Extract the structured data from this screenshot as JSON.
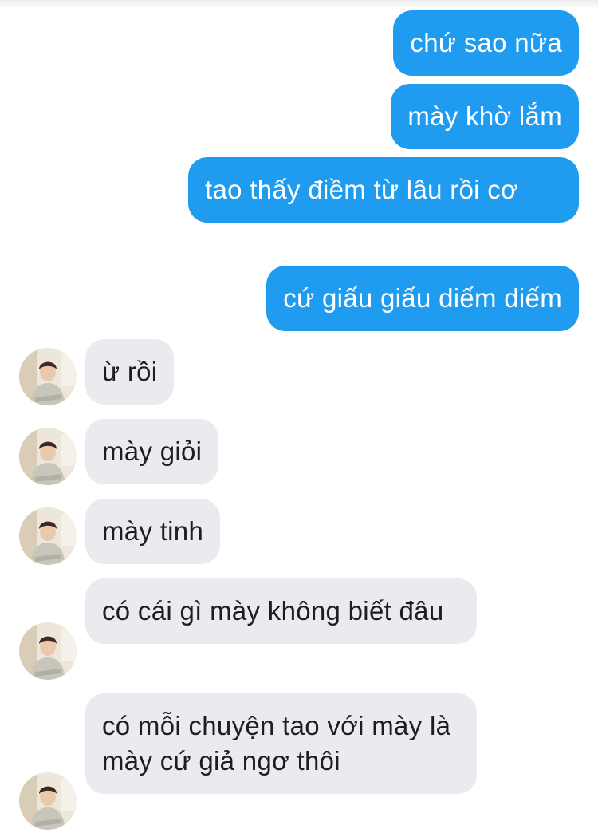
{
  "conversation": {
    "messages": [
      {
        "sender": "me",
        "text": "chứ sao nữa"
      },
      {
        "sender": "me",
        "text": "mày khờ lắm"
      },
      {
        "sender": "me",
        "text": "tao thấy điềm từ lâu rồi cơ"
      },
      {
        "sender": "me",
        "text": "cứ giấu giấu diếm diếm"
      },
      {
        "sender": "other",
        "text": "ừ rồi"
      },
      {
        "sender": "other",
        "text": "mày giỏi"
      },
      {
        "sender": "other",
        "text": "mày tinh"
      },
      {
        "sender": "other",
        "text": "có cái gì mày không biết đâu"
      },
      {
        "sender": "other",
        "text": "có mỗi chuyện tao với mày là mày cứ giả ngơ thôi"
      }
    ]
  },
  "colors": {
    "outgoing_bubble": "#1f9cf0",
    "incoming_bubble": "#e9ebef",
    "background": "#ffffff"
  },
  "icons": {
    "avatar": "profile-photo-icon"
  }
}
